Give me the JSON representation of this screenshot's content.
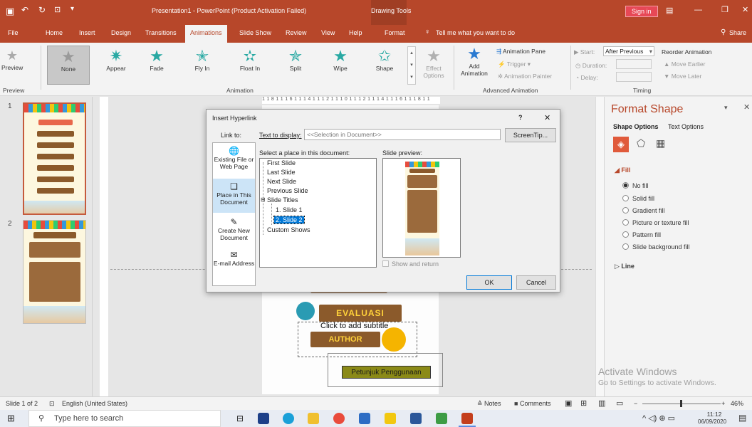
{
  "titlebar": {
    "title": "Presentation1  -  PowerPoint (Product Activation Failed)",
    "context_tab": "Drawing Tools",
    "sign_in": "Sign in"
  },
  "tabs": [
    "File",
    "Home",
    "Insert",
    "Design",
    "Transitions",
    "Animations",
    "Slide Show",
    "Review",
    "View",
    "Help",
    "Format"
  ],
  "active_tab": "Animations",
  "tell_me": "Tell me what you want to do",
  "share": "Share",
  "ribbon": {
    "preview": "Preview",
    "effects": [
      "None",
      "Appear",
      "Fade",
      "Fly In",
      "Float In",
      "Split",
      "Wipe",
      "Shape"
    ],
    "effect_options": "Effect Options",
    "add_animation": "Add Animation",
    "animation_pane": "Animation Pane",
    "trigger": "Trigger",
    "animation_painter": "Animation Painter",
    "start_label": "Start:",
    "start_value": "After Previous",
    "duration_label": "Duration:",
    "delay_label": "Delay:",
    "reorder": "Reorder Animation",
    "move_earlier": "Move Earlier",
    "move_later": "Move Later",
    "groups": {
      "preview": "Preview",
      "animation": "Animation",
      "advanced": "Advanced Animation",
      "timing": "Timing"
    }
  },
  "ruler_top": "1 1 8 1 1 1 6 1 1 1 4 1 1 1 2 1 1 1 0 1 1 1 2 1 1 1 4 1 1 1 6 1 1 1 8 1 1",
  "slides": [
    {
      "num": "1"
    },
    {
      "num": "2"
    }
  ],
  "slide_content": {
    "evaluasi": "EVALUASI",
    "subtitle": "Click to add subtitle",
    "author": "AUTHOR",
    "petunjuk": "Petunjuk Penggunaan"
  },
  "format_pane": {
    "title": "Format Shape",
    "shape_options": "Shape Options",
    "text_options": "Text Options",
    "fill": "Fill",
    "fill_options": [
      "No fill",
      "Solid fill",
      "Gradient fill",
      "Picture or texture fill",
      "Pattern fill",
      "Slide background fill"
    ],
    "fill_selected": 0,
    "line": "Line"
  },
  "dialog": {
    "title": "Insert Hyperlink",
    "help": "?",
    "close": "✕",
    "link_to": "Link to:",
    "text_to_display_label": "Text to display:",
    "text_to_display_value": "<<Selection in Document>>",
    "screentip": "ScreenTip...",
    "link_options": [
      {
        "label": "Existing File or Web Page"
      },
      {
        "label": "Place in This Document"
      },
      {
        "label": "Create New Document"
      },
      {
        "label": "E-mail Address"
      }
    ],
    "select_place": "Select a place in this document:",
    "tree": [
      "First Slide",
      "Last Slide",
      "Next Slide",
      "Previous Slide",
      "Slide Titles",
      "1. Slide 1",
      "2. Slide 2",
      "Custom Shows"
    ],
    "slide_preview": "Slide preview:",
    "show_and_return": "Show and return",
    "ok": "OK",
    "cancel": "Cancel"
  },
  "status": {
    "slide_info": "Slide 1 of 2",
    "language": "English (United States)",
    "notes": "Notes",
    "comments": "Comments",
    "zoom": "46%"
  },
  "watermark": {
    "line1": "Activate Windows",
    "line2": "Go to Settings to activate Windows."
  },
  "taskbar": {
    "search": "Type here to search",
    "time": "11:12",
    "date": "06/09/2020"
  },
  "colors": {
    "accent": "#b7472a",
    "selection": "#0078d7"
  }
}
